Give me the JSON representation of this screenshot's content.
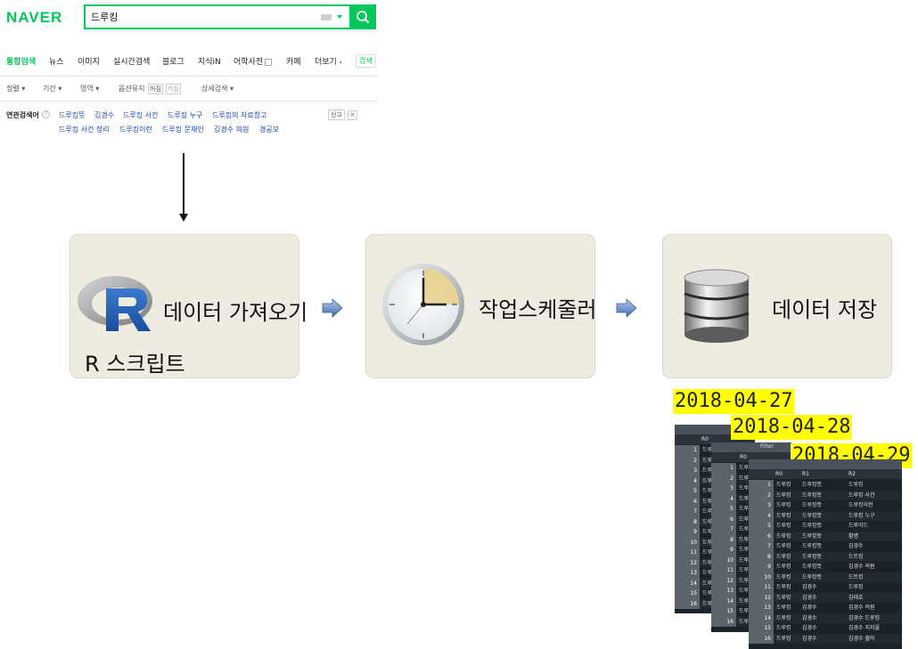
{
  "naver": {
    "logo": "NAVER",
    "query": "드루킹",
    "tabs": [
      {
        "label": "통합검색",
        "active": true
      },
      {
        "label": "뉴스"
      },
      {
        "label": "이미지"
      },
      {
        "label": "실시간검색"
      },
      {
        "label": "블로그"
      },
      {
        "label": "지식iN"
      },
      {
        "label": "어학사전"
      },
      {
        "label": "카페"
      },
      {
        "label": "더보기"
      }
    ],
    "tab_extra": "검색",
    "options": [
      "정렬",
      "기간",
      "영역",
      "옵션유지",
      "꺼짐",
      "켜짐",
      "상세검색"
    ],
    "related_label": "연관검색어",
    "related": [
      [
        "드루킹뜻",
        "김경수",
        "드루킹 사건",
        "드루킹 누구",
        "드루킹의 자료창고"
      ],
      [
        "드루킹 사건 정리",
        "드루킹이란",
        "드루킹 문재인",
        "김경수 의원",
        "경공모"
      ]
    ],
    "report": "신고",
    "colors": {
      "accent": "#03c75a",
      "link": "#1a3fb5"
    }
  },
  "steps": [
    {
      "title": "데이터 가져오기",
      "caption": "R 스크립트",
      "icon": "r-logo-icon"
    },
    {
      "title": "작업스케줄러",
      "icon": "clock-icon"
    },
    {
      "title": "데이터 저장",
      "icon": "database-icon"
    }
  ],
  "dates": [
    "2018-04-27",
    "2018-04-28",
    "2018-04-29"
  ],
  "table": {
    "filter_label": "Filter",
    "columns": [
      "R0",
      "R1",
      "R2"
    ],
    "rows": [
      {
        "i": "1",
        "r0": "드루킹",
        "r1": "드루킹뜻",
        "r2": "드루킹"
      },
      {
        "i": "2",
        "r0": "드루킹",
        "r1": "드루킹뜻",
        "r2": "드루킹 사건"
      },
      {
        "i": "3",
        "r0": "드루킹",
        "r1": "드루킹뜻",
        "r2": "드루킹이란"
      },
      {
        "i": "4",
        "r0": "드루킹",
        "r1": "드루킹뜻",
        "r2": "드루킹 누구"
      },
      {
        "i": "5",
        "r0": "드루킹",
        "r1": "드루킹뜻",
        "r2": "드루이드"
      },
      {
        "i": "6",
        "r0": "드루킹",
        "r1": "드루킹뜻",
        "r2": "황병"
      },
      {
        "i": "7",
        "r0": "드루킹",
        "r1": "드루킹뜻",
        "r2": "김경수"
      },
      {
        "i": "8",
        "r0": "드루킹",
        "r1": "드루킹뜻",
        "r2": "드트킹"
      },
      {
        "i": "9",
        "r0": "드루킹",
        "r1": "드루킹뜻",
        "r2": "김경수 의원"
      },
      {
        "i": "10",
        "r0": "드루킹",
        "r1": "드루킹뜻",
        "r2": "드트킹"
      },
      {
        "i": "11",
        "r0": "드루킹",
        "r1": "김경수",
        "r2": "드루킹"
      },
      {
        "i": "12",
        "r0": "드루킹",
        "r1": "김경수",
        "r2": "김태호"
      },
      {
        "i": "13",
        "r0": "드루킹",
        "r1": "김경수",
        "r2": "김경수 의원"
      },
      {
        "i": "14",
        "r0": "드루킹",
        "r1": "김경수",
        "r2": "김경수 드루킹"
      },
      {
        "i": "15",
        "r0": "드루킹",
        "r1": "김경수",
        "r2": "김경수 지지율"
      },
      {
        "i": "16",
        "r0": "드루킹",
        "r1": "김경수",
        "r2": "김경수 출마"
      }
    ]
  }
}
